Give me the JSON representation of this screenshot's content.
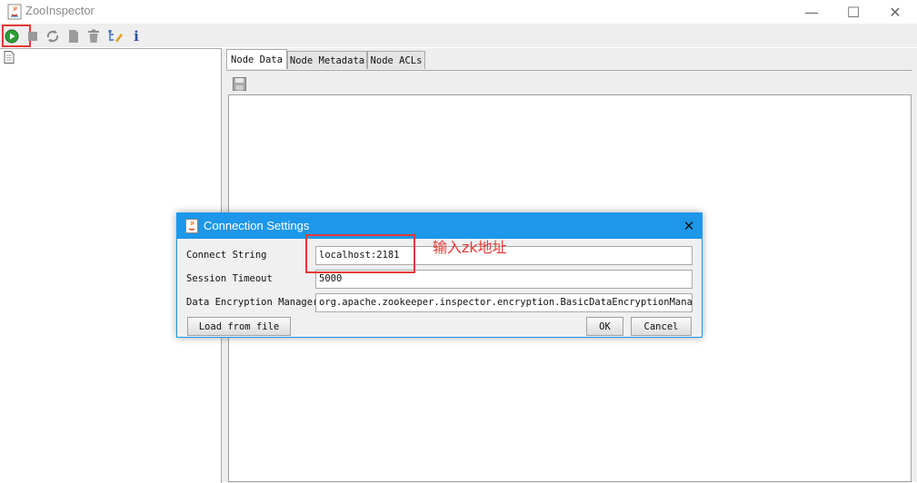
{
  "window": {
    "title": "ZooInspector",
    "minimize_glyph": "—",
    "maximize_glyph": "☐",
    "close_glyph": "✕"
  },
  "toolbar": {
    "icons": [
      "connect-icon",
      "disconnect-icon",
      "refresh-icon",
      "add-node-icon",
      "delete-node-icon",
      "change-viewers-icon",
      "about-icon"
    ],
    "about_glyph": "i"
  },
  "tabs": [
    {
      "label": "Node Data",
      "active": true
    },
    {
      "label": "Node Metadata",
      "active": false
    },
    {
      "label": "Node ACLs",
      "active": false
    }
  ],
  "annotation": {
    "text": "输入zk地址",
    "color": "#e53935"
  },
  "dialog": {
    "title": "Connection Settings",
    "close_glyph": "✕",
    "fields": [
      {
        "label": "Connect String",
        "value": "localhost:2181"
      },
      {
        "label": "Session Timeout",
        "value": "5000"
      },
      {
        "label": "Data Encryption Manager",
        "value": "org.apache.zookeeper.inspector.encryption.BasicDataEncryptionManager"
      }
    ],
    "load_button": "Load from file",
    "ok_button": "OK",
    "cancel_button": "Cancel"
  },
  "colors": {
    "dialog_titlebar": "#1c97ea",
    "panel_bg": "#eeeeee",
    "connect_green": "#2e9e3a"
  }
}
